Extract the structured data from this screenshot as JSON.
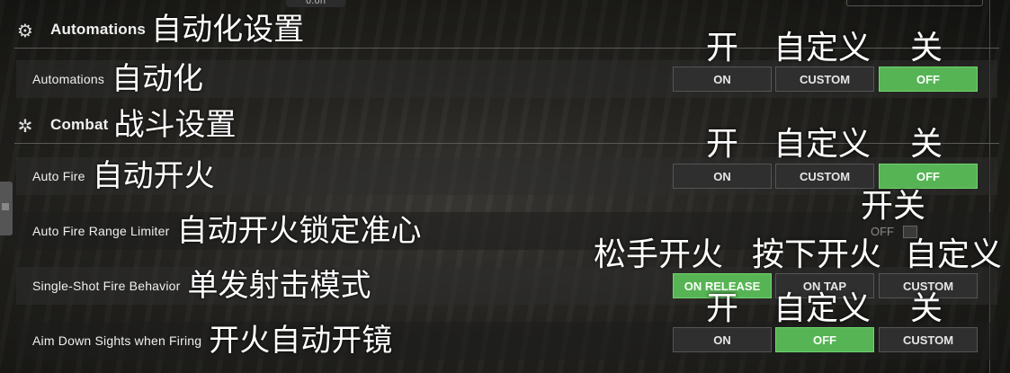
{
  "top_badge": "0.0h",
  "sections": {
    "automations": {
      "icon": "gear-icon",
      "label": "Automations",
      "annotation": "自动化设置"
    },
    "combat": {
      "icon": "crosshair-icon",
      "label": "Combat",
      "annotation": "战斗设置"
    }
  },
  "rows": {
    "automations": {
      "label": "Automations",
      "annotation": "自动化",
      "options": [
        "ON",
        "CUSTOM",
        "OFF"
      ],
      "selected": "OFF"
    },
    "auto_fire": {
      "label": "Auto Fire",
      "annotation": "自动开火",
      "options": [
        "ON",
        "CUSTOM",
        "OFF"
      ],
      "selected": "OFF"
    },
    "auto_fire_range_limiter": {
      "label": "Auto Fire Range Limiter",
      "annotation": "自动开火锁定准心",
      "toggle_state": "OFF"
    },
    "single_shot": {
      "label": "Single-Shot Fire Behavior",
      "annotation": "单发射击模式",
      "options": [
        "ON RELEASE",
        "ON TAP",
        "CUSTOM"
      ],
      "selected": "ON RELEASE"
    },
    "ads_firing": {
      "label": "Aim Down Sights when Firing",
      "annotation": "开火自动开镜",
      "options": [
        "ON",
        "OFF",
        "CUSTOM"
      ],
      "selected": "OFF"
    }
  },
  "annotations": {
    "row1": [
      "开",
      "自定义",
      "关"
    ],
    "row2": [
      "开",
      "自定义",
      "关"
    ],
    "toggle": "开关",
    "row4": [
      "松手开火",
      "按下开火",
      "自定义"
    ],
    "row5": [
      "开",
      "自定义",
      "关"
    ]
  },
  "colors": {
    "selected": "#57b455",
    "button": "#2f2f2f"
  }
}
